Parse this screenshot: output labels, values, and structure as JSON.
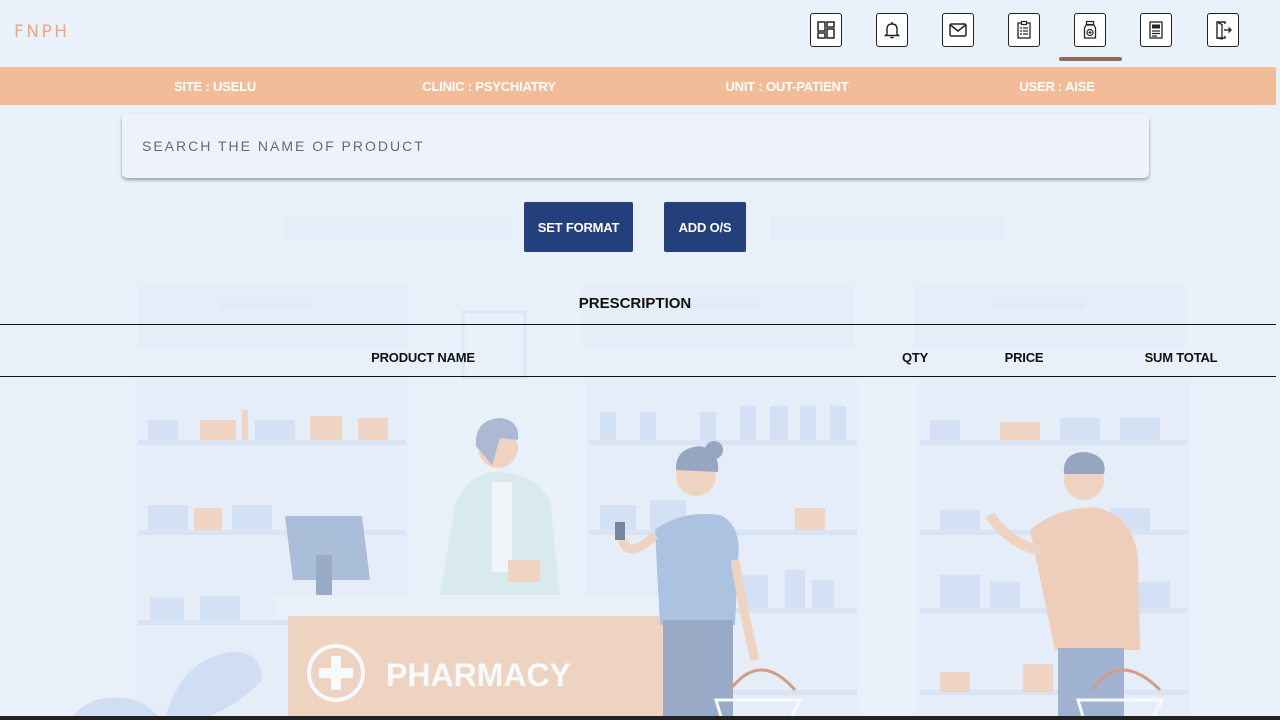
{
  "app": {
    "brand": "FNPH"
  },
  "nav": {
    "items": [
      {
        "name": "dashboard",
        "icon": "dashboard-grid-icon"
      },
      {
        "name": "notifications",
        "icon": "bell-icon"
      },
      {
        "name": "messages",
        "icon": "envelope-icon"
      },
      {
        "name": "checklist",
        "icon": "clipboard-list-icon"
      },
      {
        "name": "pharmacy",
        "icon": "medicine-bottle-icon",
        "active": true
      },
      {
        "name": "records",
        "icon": "document-list-icon"
      },
      {
        "name": "logout",
        "icon": "exit-door-icon"
      }
    ]
  },
  "info": {
    "site": "SITE : USELU",
    "clinic": "CLINIC : PSYCHIATRY",
    "unit": "UNIT : OUT-PATIENT",
    "user": "USER : AISE"
  },
  "search": {
    "placeholder": "SEARCH THE NAME OF PRODUCT",
    "value": ""
  },
  "actions": {
    "set_format": "SET FORMAT",
    "add_os": "ADD O/S"
  },
  "prescription": {
    "title": "PRESCRIPTION",
    "columns": [
      "PRODUCT NAME",
      "QTY",
      "PRICE",
      "SUM TOTAL"
    ],
    "rows": []
  },
  "illustration": {
    "sign_text": "PHARMACY"
  },
  "colors": {
    "brand": "#f0a878",
    "info_bar": "#f2bc98",
    "button": "#233f7c",
    "background": "#e9f1fa",
    "active_indicator": "#8a6a5a"
  }
}
